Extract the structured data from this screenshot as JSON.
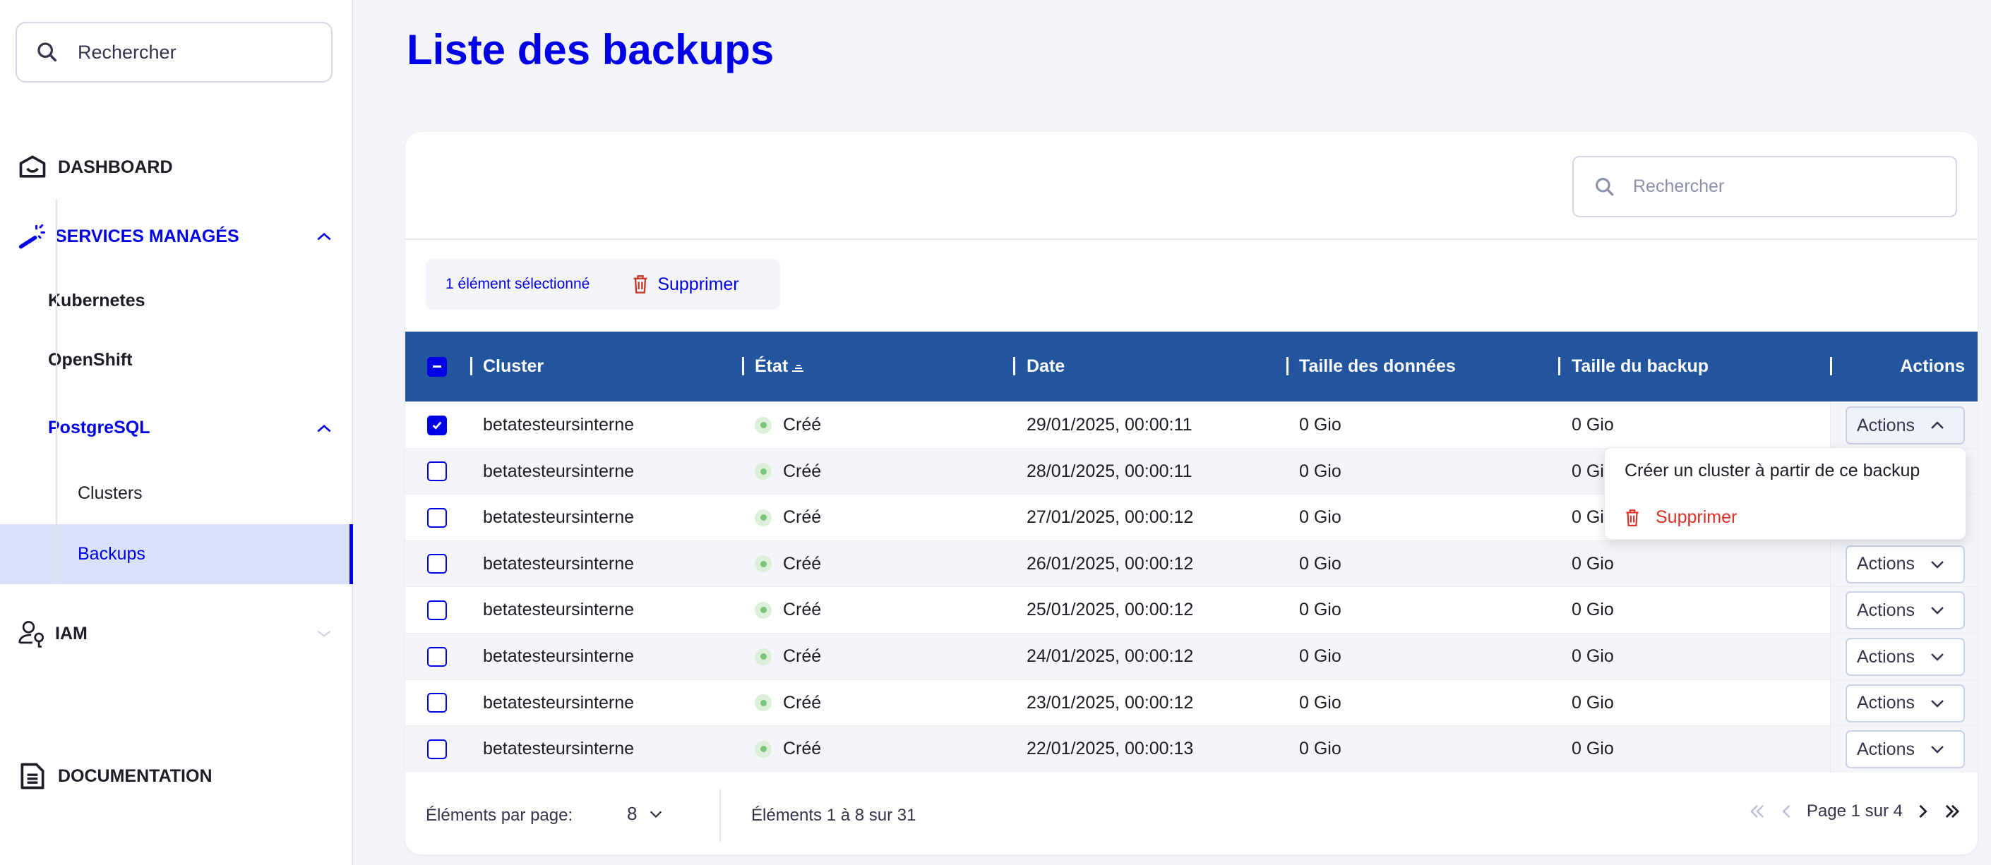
{
  "sidebar": {
    "search_placeholder": "Rechercher",
    "items": [
      {
        "label": "DASHBOARD",
        "icon": "home-icon"
      },
      {
        "label": "SERVICES MANAGÉS",
        "icon": "magic-wand-icon",
        "expanded": true
      },
      {
        "label": "Kubernetes"
      },
      {
        "label": "OpenShift"
      },
      {
        "label": "PostgreSQL",
        "expanded": true
      },
      {
        "label": "Clusters"
      },
      {
        "label": "Backups",
        "active": true
      },
      {
        "label": "IAM",
        "icon": "user-key-icon",
        "expanded": false
      },
      {
        "label": "DOCUMENTATION",
        "icon": "document-icon"
      }
    ]
  },
  "page": {
    "title": "Liste des backups"
  },
  "table": {
    "search_placeholder": "Rechercher",
    "selection_text": "1 élément sélectionné",
    "delete_label": "Supprimer",
    "columns": [
      "Cluster",
      "État",
      "Date",
      "Taille des données",
      "Taille du backup",
      "Actions"
    ],
    "rows": [
      {
        "cluster": "betatesteursinterne",
        "state": "Créé",
        "date": "29/01/2025, 00:00:11",
        "data_size": "0 Gio",
        "backup_size": "0 Gio",
        "action": "Actions",
        "checked": true
      },
      {
        "cluster": "betatesteursinterne",
        "state": "Créé",
        "date": "28/01/2025, 00:00:11",
        "data_size": "0 Gio",
        "backup_size": "0 Gio",
        "action": "Actions",
        "checked": false
      },
      {
        "cluster": "betatesteursinterne",
        "state": "Créé",
        "date": "27/01/2025, 00:00:12",
        "data_size": "0 Gio",
        "backup_size": "0 Gio",
        "action": "Actions",
        "checked": false
      },
      {
        "cluster": "betatesteursinterne",
        "state": "Créé",
        "date": "26/01/2025, 00:00:12",
        "data_size": "0 Gio",
        "backup_size": "0 Gio",
        "action": "Actions",
        "checked": false
      },
      {
        "cluster": "betatesteursinterne",
        "state": "Créé",
        "date": "25/01/2025, 00:00:12",
        "data_size": "0 Gio",
        "backup_size": "0 Gio",
        "action": "Actions",
        "checked": false
      },
      {
        "cluster": "betatesteursinterne",
        "state": "Créé",
        "date": "24/01/2025, 00:00:12",
        "data_size": "0 Gio",
        "backup_size": "0 Gio",
        "action": "Actions",
        "checked": false
      },
      {
        "cluster": "betatesteursinterne",
        "state": "Créé",
        "date": "23/01/2025, 00:00:12",
        "data_size": "0 Gio",
        "backup_size": "0 Gio",
        "action": "Actions",
        "checked": false
      },
      {
        "cluster": "betatesteursinterne",
        "state": "Créé",
        "date": "22/01/2025, 00:00:13",
        "data_size": "0 Gio",
        "backup_size": "0 Gio",
        "action": "Actions",
        "checked": false
      }
    ],
    "menu": {
      "create": "Créer un cluster à partir de ce backup",
      "delete": "Supprimer"
    },
    "footer": {
      "per_page_label": "Éléments par page:",
      "per_page": "8",
      "range": "Éléments 1 à 8 sur 31",
      "page": "Page 1 sur 4"
    }
  },
  "colors": {
    "accent": "#0000e6",
    "header": "#23559f",
    "danger": "#d93025",
    "status_ok": "#7bc27b"
  }
}
